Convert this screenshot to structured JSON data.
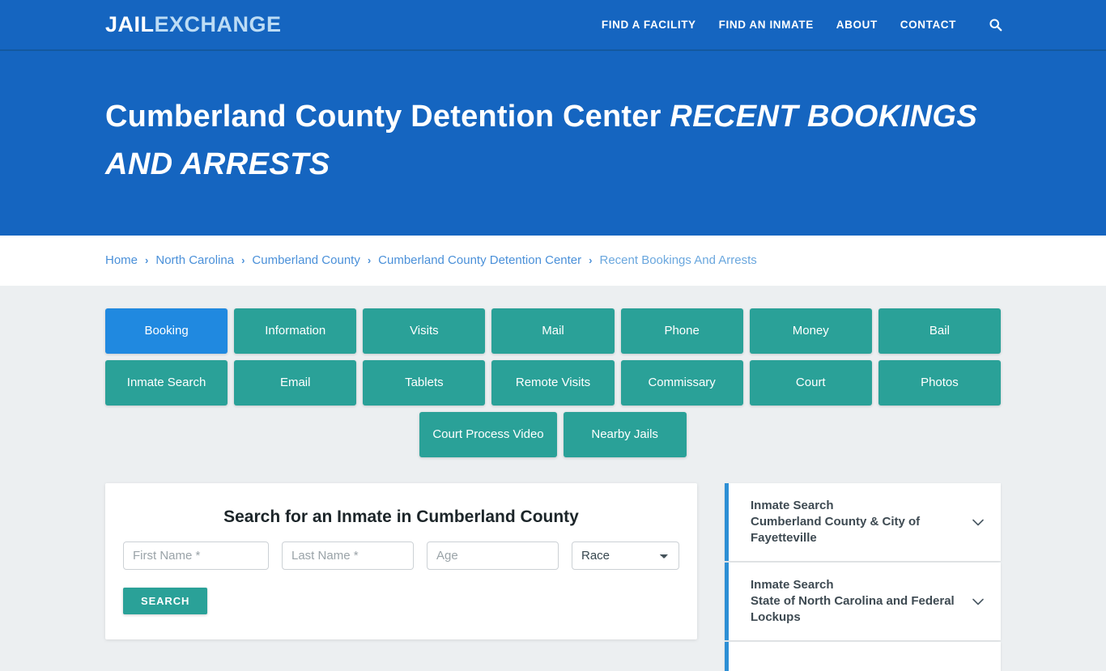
{
  "header": {
    "logo_primary": "JAIL",
    "logo_secondary": "EXCHANGE",
    "nav": [
      {
        "label": "FIND A FACILITY"
      },
      {
        "label": "FIND AN INMATE"
      },
      {
        "label": "ABOUT"
      },
      {
        "label": "CONTACT"
      }
    ],
    "search_icon": "search-icon",
    "accent_blue": "#1565c0"
  },
  "hero": {
    "title_main": "Cumberland County Detention Center",
    "title_sub": "RECENT BOOKINGS AND ARRESTS"
  },
  "breadcrumb": {
    "separator": "›",
    "items": [
      {
        "label": "Home"
      },
      {
        "label": "North Carolina"
      },
      {
        "label": "Cumberland County"
      },
      {
        "label": "Cumberland County Detention Center"
      },
      {
        "label": "Recent Bookings And Arrests"
      }
    ]
  },
  "tiles": {
    "active_color": "#2089e0",
    "default_color": "#2aa198",
    "row1": [
      {
        "label": "Booking",
        "active": true
      },
      {
        "label": "Information",
        "active": false
      },
      {
        "label": "Visits",
        "active": false
      },
      {
        "label": "Mail",
        "active": false
      },
      {
        "label": "Phone",
        "active": false
      },
      {
        "label": "Money",
        "active": false
      },
      {
        "label": "Bail",
        "active": false
      }
    ],
    "row2": [
      {
        "label": "Inmate Search",
        "active": false
      },
      {
        "label": "Email",
        "active": false
      },
      {
        "label": "Tablets",
        "active": false
      },
      {
        "label": "Remote Visits",
        "active": false
      },
      {
        "label": "Commissary",
        "active": false
      },
      {
        "label": "Court",
        "active": false
      },
      {
        "label": "Photos",
        "active": false
      }
    ],
    "row3": [
      {
        "label": "Court Process Video",
        "active": false
      },
      {
        "label": "Nearby Jails",
        "active": false
      }
    ]
  },
  "search_form": {
    "heading": "Search for an Inmate in Cumberland County",
    "first_name_placeholder": "First Name *",
    "first_name_value": "",
    "last_name_placeholder": "Last Name *",
    "last_name_value": "",
    "age_placeholder": "Age",
    "age_value": "",
    "race_selected": "Race",
    "race_options": [
      "Race"
    ],
    "submit_label": "SEARCH"
  },
  "sidebar": {
    "panels": [
      {
        "line1": "Inmate Search",
        "line2": "Cumberland County & City of Fayetteville",
        "icon": "chevron-down-icon"
      },
      {
        "line1": "Inmate Search",
        "line2": "State of North Carolina and Federal Lockups",
        "icon": "chevron-down-icon"
      },
      {
        "line1": "",
        "line2": "",
        "icon": "chevron-down-icon"
      }
    ]
  }
}
